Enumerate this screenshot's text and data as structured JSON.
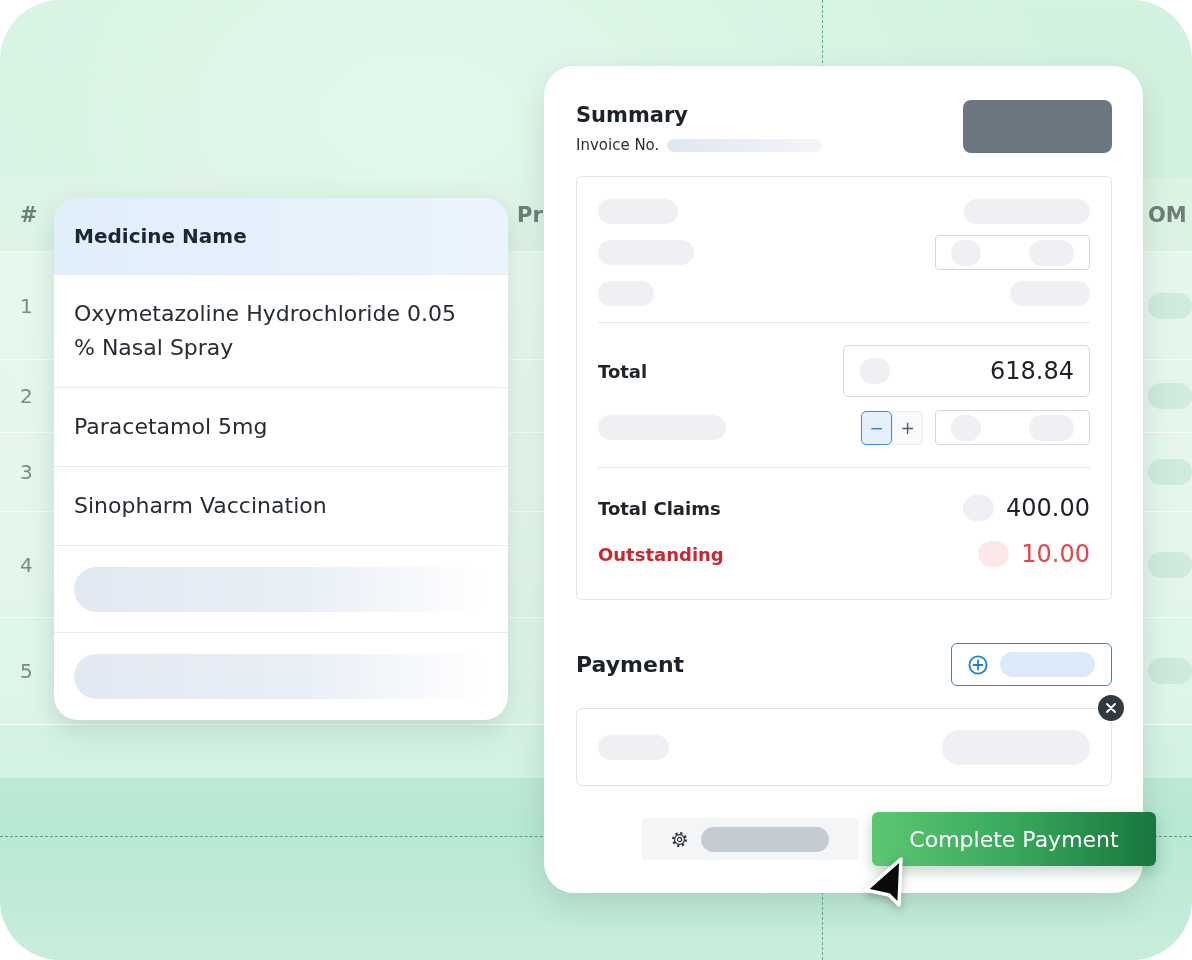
{
  "background_table": {
    "columns": [
      {
        "label": "#"
      },
      {
        "label": "Pr"
      },
      {
        "label": "OM"
      }
    ],
    "rows": [
      {
        "number": "1"
      },
      {
        "number": "2"
      },
      {
        "number": "3"
      },
      {
        "number": "4"
      },
      {
        "number": "5"
      }
    ]
  },
  "medicine_card": {
    "header": "Medicine Name",
    "rows": [
      {
        "kind": "text",
        "name": "Oxymetazoline Hydrochloride 0.05 % Nasal Spray"
      },
      {
        "kind": "text",
        "name": "Paracetamol 5mg"
      },
      {
        "kind": "text",
        "name": "Sinopharm Vaccination"
      },
      {
        "kind": "placeholder"
      },
      {
        "kind": "placeholder"
      }
    ]
  },
  "summary": {
    "title": "Summary",
    "invoice_label": "Invoice No.",
    "total": {
      "label": "Total",
      "value": "618.84"
    },
    "stepper": [
      {
        "symbol": "−",
        "selected": true
      },
      {
        "symbol": "+",
        "selected": false
      }
    ],
    "balances": [
      {
        "kind": "normal",
        "label": "Total Claims",
        "value": "400.00"
      },
      {
        "kind": "alert",
        "label": "Outstanding",
        "value": "10.00"
      }
    ]
  },
  "payment": {
    "title": "Payment"
  },
  "complete_button": {
    "label": "Complete Payment"
  }
}
